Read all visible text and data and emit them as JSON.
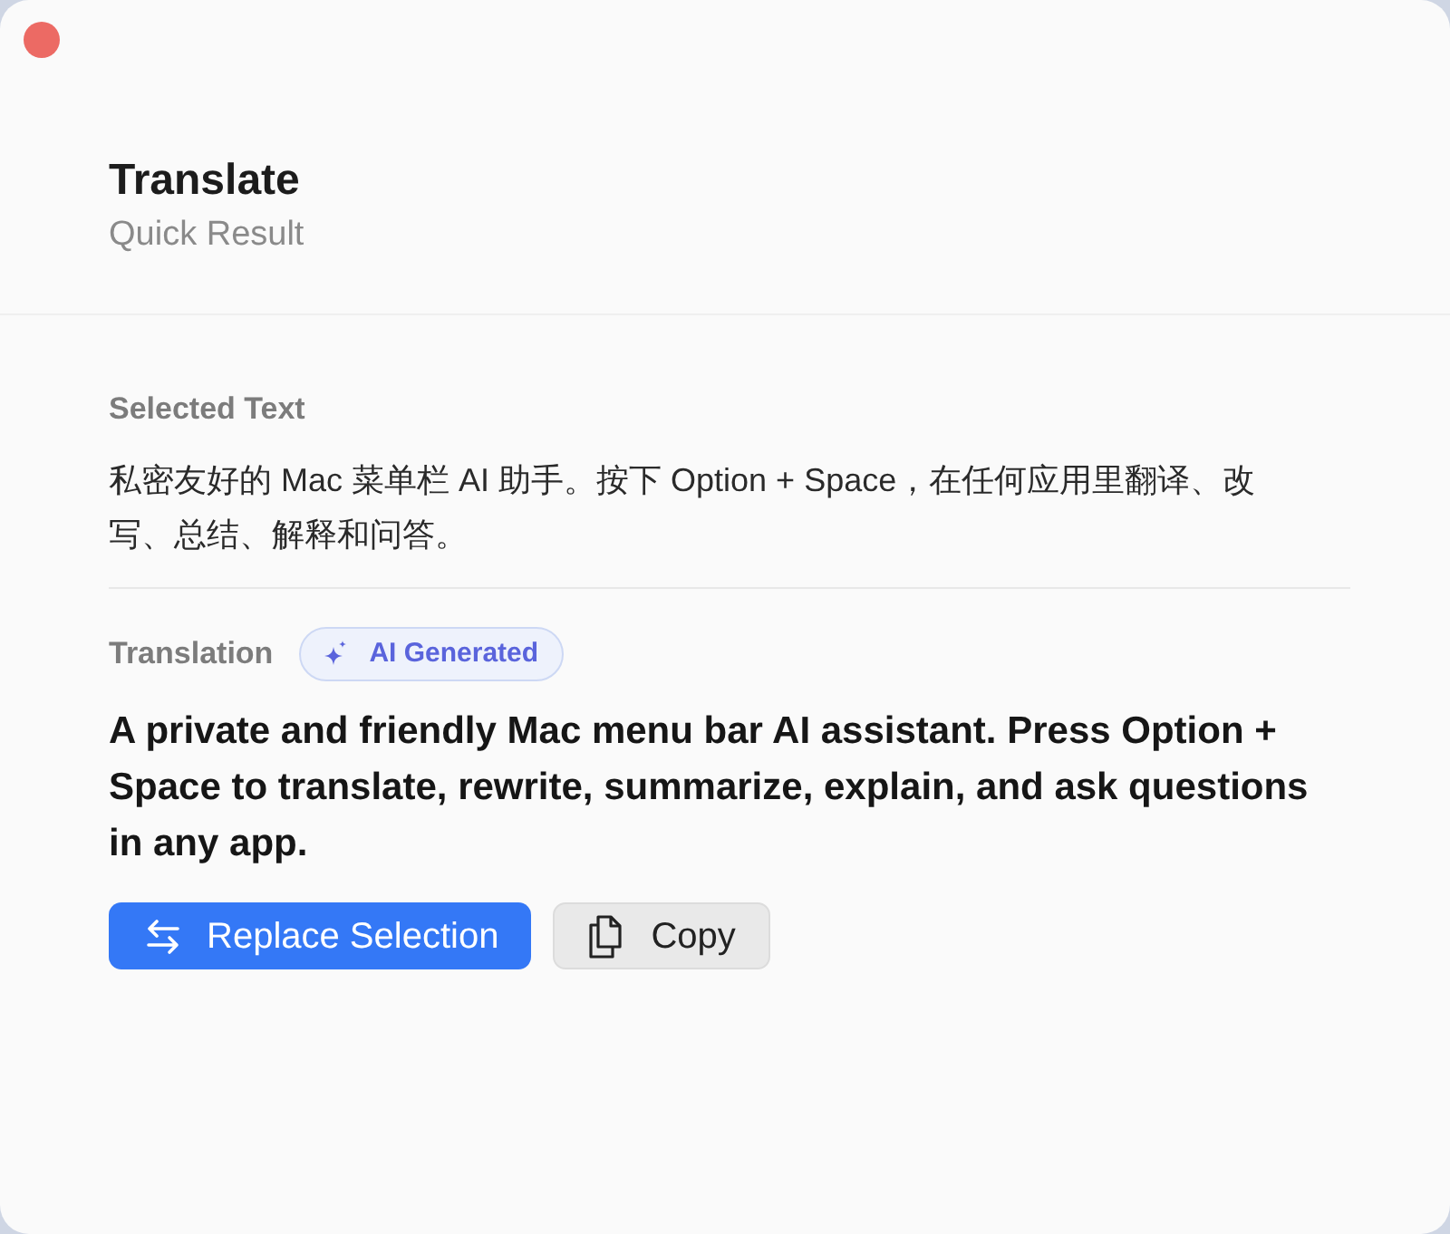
{
  "window": {
    "title": "Translate",
    "subtitle": "Quick Result"
  },
  "selected_text": {
    "label": "Selected Text",
    "text": "私密友好的 Mac 菜单栏 AI 助手。按下 Option + Space，在任何应用里翻译、改写、总结、解释和问答。"
  },
  "translation": {
    "label": "Translation",
    "badge": "AI Generated",
    "text": "A private and friendly Mac menu bar AI assistant. Press Option + Space to translate, rewrite, summarize, explain, and ask questions in any app."
  },
  "buttons": [
    {
      "label": "Replace Selection",
      "kind": "primary"
    },
    {
      "label": "Copy",
      "kind": "secondary"
    }
  ]
}
